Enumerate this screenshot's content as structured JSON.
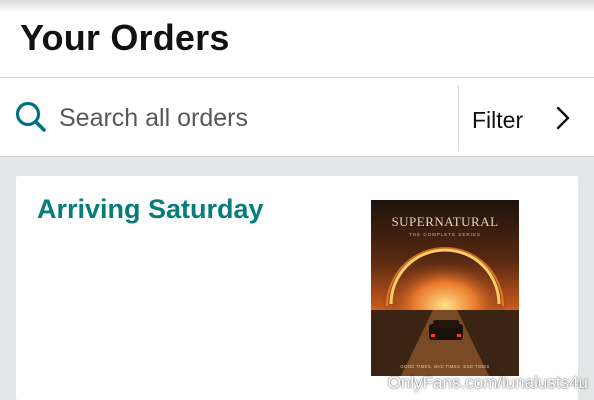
{
  "header": {
    "title": "Your Orders"
  },
  "search": {
    "placeholder": "Search all orders",
    "icon": "search-icon"
  },
  "filter": {
    "label": "Filter",
    "icon": "chevron-right-icon"
  },
  "orders": [
    {
      "status": "Arriving Saturday",
      "product_image": {
        "title": "SUPERNATURAL",
        "subtitle": "THE COMPLETE SERIES",
        "tagline": "GOOD TIMES, BAD TIMES, END TIMES"
      }
    }
  ],
  "watermark": "OnlyFans.com/lunalusts4u",
  "colors": {
    "status_teal": "#067d7b",
    "search_icon_teal": "#007185",
    "divider": "#d5d9d9",
    "list_background": "#e3e6e6"
  }
}
